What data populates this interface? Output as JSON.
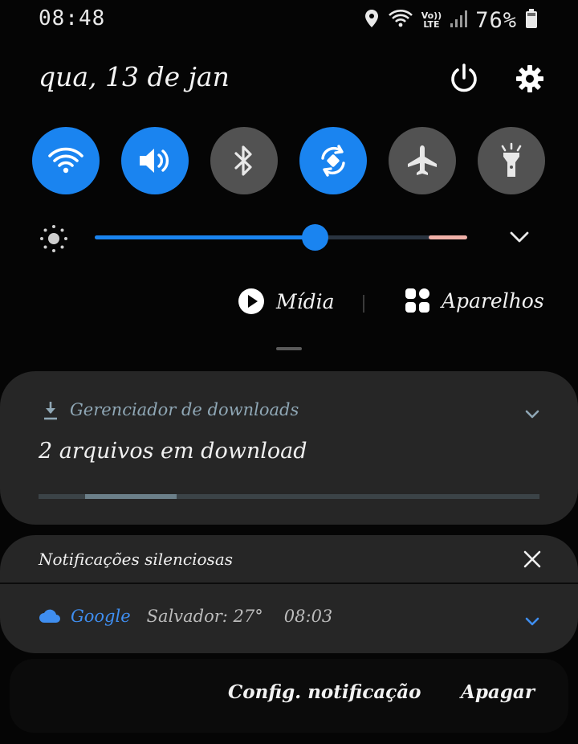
{
  "status_bar": {
    "time": "08:48",
    "lte_top": "Vo))",
    "lte_bottom": "LTE",
    "battery_text": "76%",
    "icons": [
      "location-icon",
      "wifi-icon",
      "signal-icon",
      "battery-icon"
    ]
  },
  "header": {
    "date": "qua, 13 de jan",
    "icons": [
      "power-icon",
      "settings-icon"
    ]
  },
  "quick_tiles": [
    {
      "icon": "wifi-icon",
      "state": "on"
    },
    {
      "icon": "volume-icon",
      "state": "on"
    },
    {
      "icon": "bluetooth-icon",
      "state": "off"
    },
    {
      "icon": "auto-rotate-icon",
      "state": "on"
    },
    {
      "icon": "airplane-icon",
      "state": "off"
    },
    {
      "icon": "flashlight-icon",
      "state": "off"
    }
  ],
  "brightness": {
    "level": 0.59
  },
  "media_buttons": {
    "media_label": "Mídia",
    "devices_label": "Aparelhos"
  },
  "download_notification": {
    "app": "Gerenciador de downloads",
    "body": "2 arquivos em download",
    "progress": 0.29
  },
  "silent_notifications": {
    "title": "Notificações silenciosas",
    "google": {
      "app": "Google",
      "text": "Salvador: 27°",
      "time": "08:03"
    }
  },
  "actions": {
    "settings_label": "Config. notificação",
    "clear_label": "Apagar"
  },
  "colors": {
    "accent": "#1a84f0",
    "tile_off": "#525252",
    "card": "#262626"
  }
}
